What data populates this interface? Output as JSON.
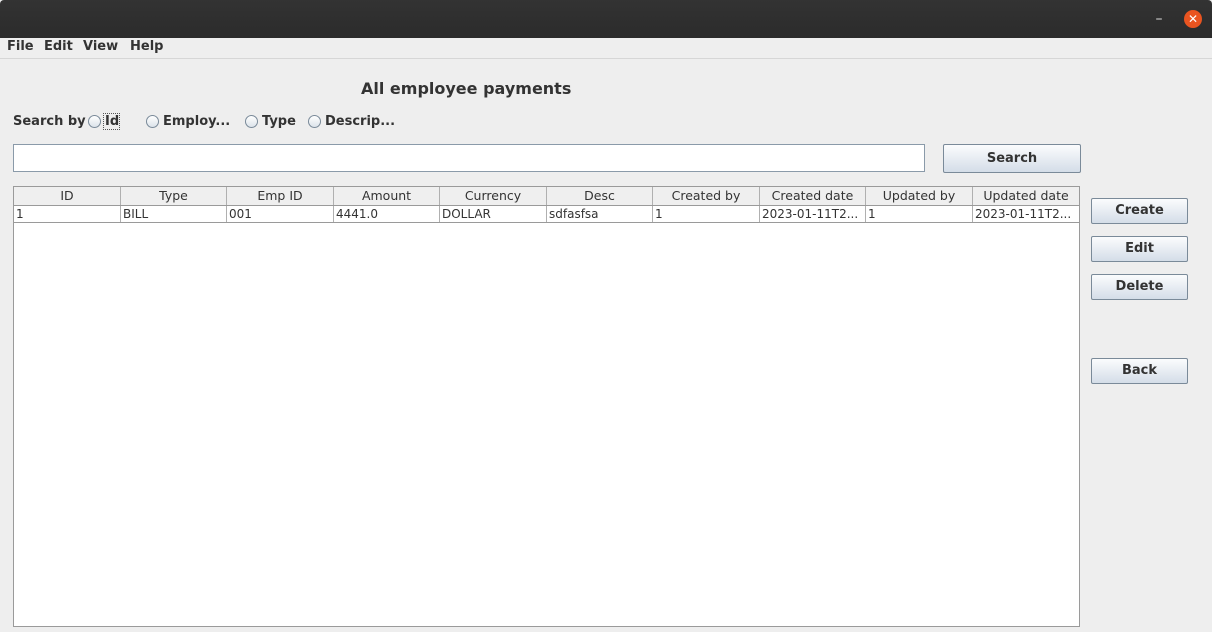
{
  "window": {
    "minimize_glyph": "–",
    "close_glyph": "✕"
  },
  "menu": [
    "File",
    "Edit",
    "View",
    "Help"
  ],
  "heading": "All employee payments",
  "search": {
    "label": "Search by",
    "options": [
      "Id",
      "Employ...",
      "Type",
      "Descrip..."
    ],
    "button": "Search",
    "value": ""
  },
  "actions": {
    "create": "Create",
    "edit": "Edit",
    "delete": "Delete",
    "back": "Back"
  },
  "table": {
    "columns": [
      "ID",
      "Type",
      "Emp ID",
      "Amount",
      "Currency",
      "Desc",
      "Created by",
      "Created date",
      "Updated by",
      "Updated date"
    ],
    "rows": [
      [
        "1",
        "BILL",
        "001",
        "4441.0",
        "DOLLAR",
        "sdfasfsa",
        "1",
        "2023-01-11T2...",
        "1",
        "2023-01-11T2..."
      ]
    ]
  },
  "colors": {
    "titlebar": "#2b2b2b",
    "close": "#e95420"
  }
}
